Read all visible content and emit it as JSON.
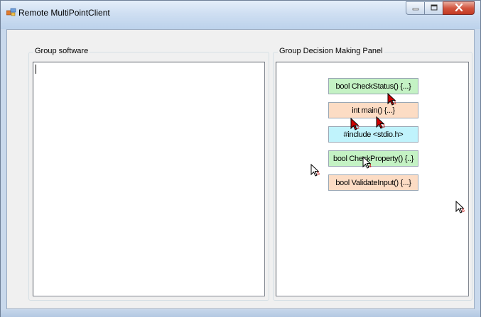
{
  "window": {
    "title": "Remote MultiPointClient",
    "minimize_icon": "minimize-icon",
    "maximize_icon": "maximize-icon",
    "close_icon": "close-icon",
    "app_icon": "app-icon"
  },
  "left_group": {
    "label": "Group software",
    "text_value": ""
  },
  "right_group": {
    "label": "Group Decision Making Panel",
    "code_blocks": [
      {
        "text": "bool CheckStatus() {...}",
        "color": "#c4f2c4"
      },
      {
        "text": "int main() {...}",
        "color": "#fcdcc4"
      },
      {
        "text": "#include <stdio.h>",
        "color": "#c0f3fc"
      },
      {
        "text": "bool CheckProperty() {..}",
        "color": "#c4f2c4"
      },
      {
        "text": "bool ValidateInput() {...}",
        "color": "#fcdcc4"
      }
    ],
    "cursors": [
      {
        "label": "1",
        "style": "red"
      },
      {
        "label": "2",
        "style": "red"
      },
      {
        "label": "3",
        "style": "red"
      },
      {
        "label": "4",
        "style": "white"
      },
      {
        "label": "5",
        "style": "white"
      },
      {
        "label": "6",
        "style": "white"
      }
    ]
  },
  "colors": {
    "red_cursor": "#d00000",
    "white_cursor": "#ffffff"
  }
}
